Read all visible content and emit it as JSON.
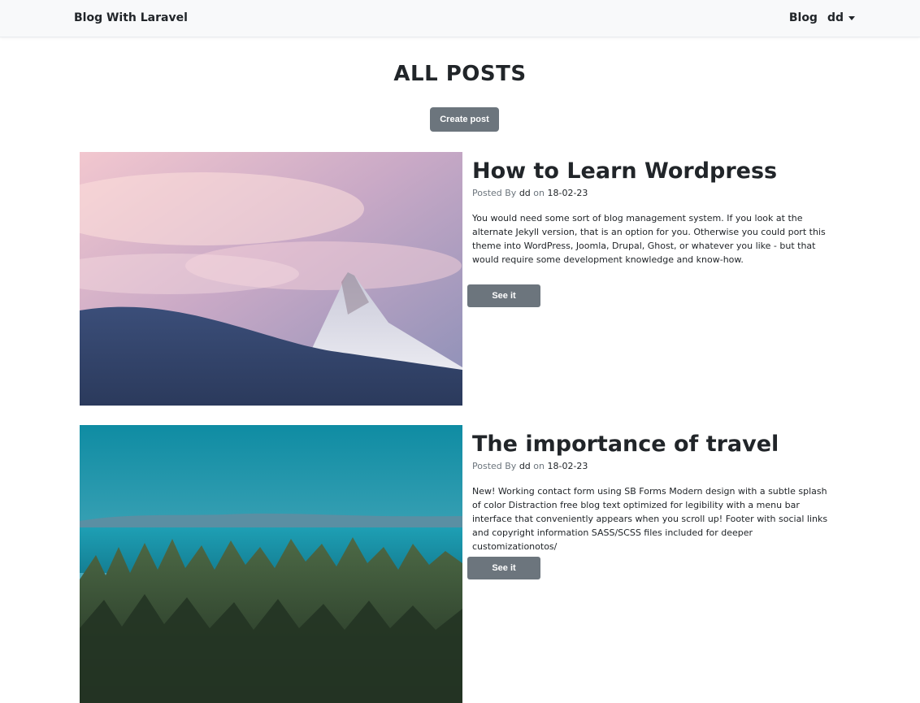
{
  "navbar": {
    "brand": "Blog With Laravel",
    "blog_link": "Blog",
    "user_menu": "dd"
  },
  "page": {
    "title": "ALL POSTS",
    "create_button": "Create post"
  },
  "posts": [
    {
      "title": "How to Learn Wordpress",
      "posted_by_label": "Posted By",
      "author": "dd",
      "on_label": "on",
      "date": "18-02-23",
      "excerpt": "You would need some sort of blog management system. If you look at the alternate Jekyll version, that is an option for you. Otherwise you could port this theme into WordPress, Joomla, Drupal, Ghost, or whatever you like - but that would require some development knowledge and know-how.",
      "button": "See it",
      "image": "mountain-snow-peak-image"
    },
    {
      "title": "The importance of travel",
      "posted_by_label": "Posted By",
      "author": "dd",
      "on_label": "on",
      "date": "18-02-23",
      "excerpt": "New! Working contact form using SB Forms Modern design with a subtle splash of color Distraction free blog text optimized for legibility with a menu bar interface that conveniently appears when you scroll up! Footer with social links and copyright information SASS/SCSS files included for deeper customizationotos/",
      "button": "See it",
      "image": "forest-lake-image"
    }
  ],
  "colors": {
    "navbar_bg": "#f8f9fa",
    "secondary_button": "#6c757d",
    "text": "#212529",
    "muted": "#6c757d"
  }
}
